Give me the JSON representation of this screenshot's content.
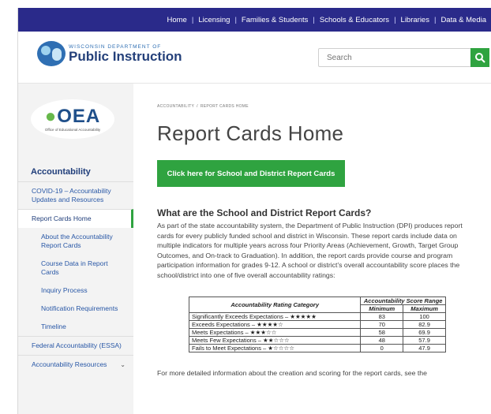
{
  "topnav": {
    "links": [
      "Home",
      "Licensing",
      "Families & Students",
      "Schools & Educators",
      "Libraries",
      "Data & Media"
    ],
    "separator": "|"
  },
  "header": {
    "logo_small": "WISCONSIN DEPARTMENT OF",
    "logo_big": "Public Instruction",
    "search_placeholder": "Search",
    "search_icon": "search-icon"
  },
  "sidebar": {
    "oea_title": "OEA",
    "oea_subtitle": "Office of Educational Accountability",
    "heading": "Accountability",
    "items": [
      {
        "label": "COVID-19 – Accountability Updates and Resources"
      },
      {
        "label": "Report Cards Home",
        "active": true
      },
      {
        "label": "About the Accountability Report Cards"
      },
      {
        "label": "Course Data in Report Cards"
      },
      {
        "label": "Inquiry Process"
      },
      {
        "label": "Notification Requirements"
      },
      {
        "label": "Timeline"
      },
      {
        "label": "Federal Accountability (ESSA)"
      },
      {
        "label": "Accountability Resources"
      }
    ]
  },
  "main": {
    "breadcrumb": [
      "ACCOUNTABILITY",
      "REPORT CARDS HOME"
    ],
    "title": "Report Cards Home",
    "cta_label": "Click here for School and District Report Cards",
    "section_heading": "What are the School and District Report Cards?",
    "paragraph": "As part of the state accountability system, the Department of Public Instruction (DPI) produces report cards for every publicly funded school and district in Wisconsin. These report cards include data on multiple indicators for multiple years across four Priority Areas (Achievement, Growth, Target Group Outcomes, and On-track to Graduation). In addition, the report cards provide course and program participation information for grades 9-12. A school or district’s overall accountability score places the school/district into one of five overall accountability ratings:",
    "table": {
      "category_header": "Accountability Rating Category",
      "range_header": "Accountability Score Range",
      "min_header": "Minimum",
      "max_header": "Maximum",
      "rows": [
        {
          "category": "Significantly Exceeds Expectations – ★★★★★",
          "min": "83",
          "max": "100"
        },
        {
          "category": "Exceeds Expectations – ★★★★☆",
          "min": "70",
          "max": "82.9"
        },
        {
          "category": "Meets Expectations – ★★★☆☆",
          "min": "58",
          "max": "69.9"
        },
        {
          "category": "Meets Few Expectations – ★★☆☆☆",
          "min": "48",
          "max": "57.9"
        },
        {
          "category": "Fails to Meet Expectations – ★☆☆☆☆",
          "min": "0",
          "max": "47.9"
        }
      ]
    },
    "more_text": "For more detailed information about the creation and scoring for the report cards, see the"
  },
  "colors": {
    "nav_bg": "#2a2a8a",
    "accent_green": "#2fa340",
    "link_blue": "#2857a6"
  }
}
